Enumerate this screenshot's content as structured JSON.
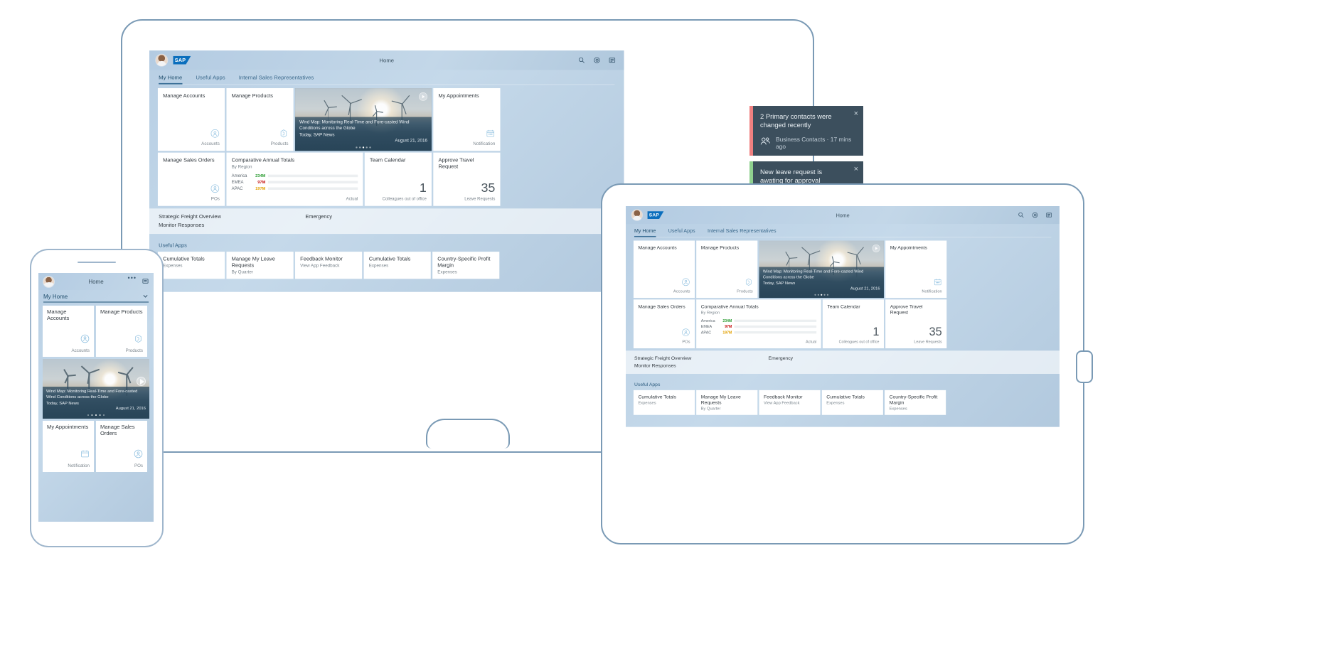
{
  "shell": {
    "header_title": "Home",
    "logo_text": "SAP",
    "icons": {
      "search": "search-icon",
      "contacts": "target-icon",
      "menu": "list-icon"
    }
  },
  "tabs": [
    {
      "label": "My Home",
      "active": true
    },
    {
      "label": "Useful Apps",
      "active": false
    },
    {
      "label": "Internal Sales Representatives",
      "active": false
    }
  ],
  "tiles_row1": [
    {
      "title": "Manage Accounts",
      "footer": "Accounts",
      "icon": "person-icon"
    },
    {
      "title": "Manage Products",
      "footer": "Products",
      "icon": "product-icon"
    }
  ],
  "news_tile": {
    "headline": "Wind Map: Monitoring Real-Time and Fore-casted Wind Conditions across the Globe",
    "source": "Today, SAP News",
    "date": "August 21, 2016",
    "dots": 5,
    "active_dot": 3
  },
  "appointments_tile": {
    "title": "My Appointments",
    "footer": "Notification",
    "icon": "calendar-icon"
  },
  "tiles_row2": {
    "sales_orders": {
      "title": "Manage Sales Orders",
      "footer": "POs",
      "icon": "person-icon"
    },
    "team_calendar": {
      "title": "Team Calendar",
      "value": "1",
      "caption": "Colleagues out of office"
    },
    "travel_request": {
      "title": "Approve Travel Request",
      "value": "35",
      "caption": "Leave Requests"
    }
  },
  "chart_data": {
    "type": "bar",
    "title": "Comparative Annual Totals",
    "subtitle": "By Region",
    "orientation": "horizontal",
    "categories": [
      "America",
      "EMEA",
      "APAC"
    ],
    "values": [
      234,
      97,
      197
    ],
    "value_labels": [
      "234M",
      "97M",
      "197M"
    ],
    "colors": [
      "#2d9d34",
      "#c40f0f",
      "#e2a000"
    ],
    "max": 250,
    "footer_label": "Actual",
    "xlabel": "",
    "ylabel": "",
    "units": "M",
    "grid": false,
    "legend": false
  },
  "link_tiles": [
    {
      "label": "Strategic Freight Overview"
    },
    {
      "label": "Emergency"
    },
    {
      "label": "Monitor Responses"
    }
  ],
  "useful_apps": {
    "group_title": "Useful Apps",
    "items": [
      {
        "title": "Cumulative Totals",
        "sub": "Expenses"
      },
      {
        "title": "Manage My Leave Requests",
        "sub": "By Quarter"
      },
      {
        "title": "Feedback Monitor",
        "sub": "View App Feedback"
      },
      {
        "title": "Cumulative Totals",
        "sub": "Expenses"
      },
      {
        "title": "Country-Specific Profit Margin",
        "sub": "Expenses"
      }
    ]
  },
  "notifications": [
    {
      "text": "2 Primary contacts were changed recently",
      "meta": "Business Contacts · 17 mins ago",
      "accent": "#f08080",
      "icon": "people-icon",
      "close": "×"
    },
    {
      "text": "New leave request is awating for approval",
      "meta": "",
      "accent": "#8fd18f",
      "icon": "",
      "close": "×"
    }
  ],
  "phone": {
    "header_title": "Home",
    "group_label": "My Home",
    "more_icon": "ellipsis-icon",
    "menu_icon": "list-icon",
    "chevron": "chevron-down-icon",
    "tiles": [
      {
        "title": "Manage Accounts",
        "footer": "Accounts"
      },
      {
        "title": "Manage Products",
        "footer": "Products"
      },
      {
        "title": "My Appointments",
        "footer": "Notification"
      },
      {
        "title": "Manage Sales Orders",
        "footer": "POs"
      }
    ]
  },
  "colors": {
    "brand_blue": "#0a6ebd",
    "tab_active": "#22506f",
    "notification_bg": "#3c4f5d",
    "green": "#2d9d34",
    "red": "#c40f0f",
    "amber": "#e2a000"
  }
}
